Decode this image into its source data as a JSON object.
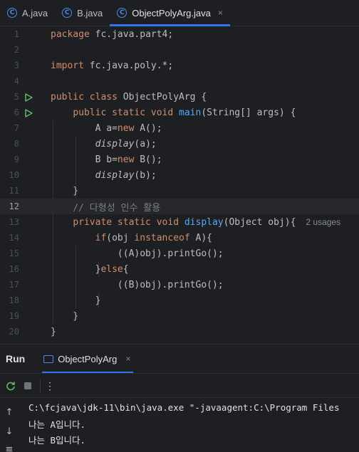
{
  "tabs": [
    {
      "label": "A.java",
      "icon": "java-class-icon",
      "active": false
    },
    {
      "label": "B.java",
      "icon": "java-class-icon",
      "active": false
    },
    {
      "label": "ObjectPolyArg.java",
      "icon": "java-class-icon",
      "active": true
    }
  ],
  "tab_close_glyph": "×",
  "editor": {
    "current_line": 12,
    "usages_hint": "2 usages",
    "line_numbers": [
      "1",
      "2",
      "3",
      "4",
      "5",
      "6",
      "7",
      "8",
      "9",
      "10",
      "11",
      "12",
      "13",
      "14",
      "15",
      "16",
      "17",
      "18",
      "19",
      "20"
    ],
    "lines": [
      [
        {
          "t": "package",
          "c": "kw"
        },
        {
          "t": " fc.java.part4;"
        }
      ],
      [],
      [
        {
          "t": "import",
          "c": "kw"
        },
        {
          "t": " fc.java.poly.*;"
        }
      ],
      [],
      [
        {
          "t": "public class",
          "c": "kw"
        },
        {
          "t": " ObjectPolyArg {"
        }
      ],
      [
        {
          "t": "    "
        },
        {
          "t": "public static void",
          "c": "kw"
        },
        {
          "t": " "
        },
        {
          "t": "main",
          "c": "fn"
        },
        {
          "t": "(String[] args) {"
        }
      ],
      [
        {
          "t": "        A a="
        },
        {
          "t": "new",
          "c": "kw"
        },
        {
          "t": " A();"
        }
      ],
      [
        {
          "t": "        "
        },
        {
          "t": "display",
          "c": "it"
        },
        {
          "t": "(a);"
        }
      ],
      [
        {
          "t": "        B b="
        },
        {
          "t": "new",
          "c": "kw"
        },
        {
          "t": " B();"
        }
      ],
      [
        {
          "t": "        "
        },
        {
          "t": "display",
          "c": "it"
        },
        {
          "t": "(b);"
        }
      ],
      [
        {
          "t": "    }"
        }
      ],
      [
        {
          "t": "    "
        },
        {
          "t": "// 다형성 인수 활용",
          "c": "cm"
        }
      ],
      [
        {
          "t": "    "
        },
        {
          "t": "private static void",
          "c": "kw"
        },
        {
          "t": " "
        },
        {
          "t": "display",
          "c": "fn"
        },
        {
          "t": "(Object obj){"
        }
      ],
      [
        {
          "t": "        "
        },
        {
          "t": "if",
          "c": "kw"
        },
        {
          "t": "(obj "
        },
        {
          "t": "instanceof",
          "c": "kw"
        },
        {
          "t": " A){"
        }
      ],
      [
        {
          "t": "            ((A)obj).printGo();"
        }
      ],
      [
        {
          "t": "        }"
        },
        {
          "t": "else",
          "c": "kw"
        },
        {
          "t": "{"
        }
      ],
      [
        {
          "t": "            ((B)obj).printGo();"
        }
      ],
      [
        {
          "t": "        }"
        }
      ],
      [
        {
          "t": "    }"
        }
      ],
      [
        {
          "t": "}"
        }
      ]
    ],
    "run_gutter_lines": [
      5,
      6
    ]
  },
  "run_panel": {
    "title": "Run",
    "tab_label": "ObjectPolyArg",
    "kebab": "⋮",
    "output": [
      "C:\\fcjava\\jdk-11\\bin\\java.exe \"-javaagent:C:\\Program Files",
      "나는 A입니다.",
      "나는 B입니다."
    ]
  },
  "colors": {
    "accent": "#3574f0",
    "keyword": "#cf8e6d",
    "method": "#56a8f5",
    "comment": "#7a7e85",
    "run_icon": "#5fb865"
  }
}
